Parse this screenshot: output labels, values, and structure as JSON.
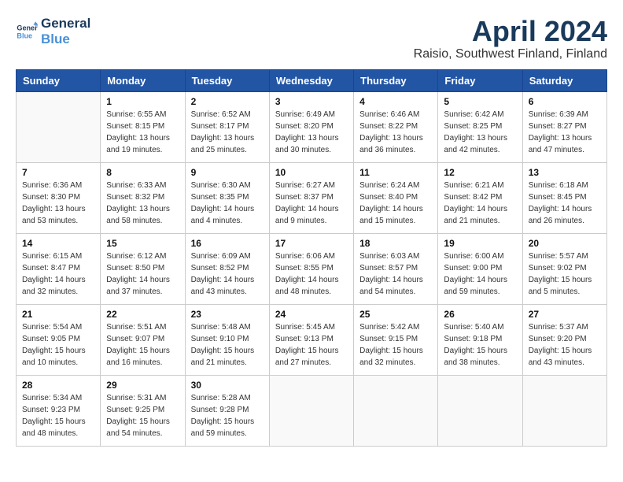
{
  "logo": {
    "line1": "General",
    "line2": "Blue"
  },
  "title": "April 2024",
  "location": "Raisio, Southwest Finland, Finland",
  "days_of_week": [
    "Sunday",
    "Monday",
    "Tuesday",
    "Wednesday",
    "Thursday",
    "Friday",
    "Saturday"
  ],
  "weeks": [
    [
      {
        "day": "",
        "info": ""
      },
      {
        "day": "1",
        "info": "Sunrise: 6:55 AM\nSunset: 8:15 PM\nDaylight: 13 hours\nand 19 minutes."
      },
      {
        "day": "2",
        "info": "Sunrise: 6:52 AM\nSunset: 8:17 PM\nDaylight: 13 hours\nand 25 minutes."
      },
      {
        "day": "3",
        "info": "Sunrise: 6:49 AM\nSunset: 8:20 PM\nDaylight: 13 hours\nand 30 minutes."
      },
      {
        "day": "4",
        "info": "Sunrise: 6:46 AM\nSunset: 8:22 PM\nDaylight: 13 hours\nand 36 minutes."
      },
      {
        "day": "5",
        "info": "Sunrise: 6:42 AM\nSunset: 8:25 PM\nDaylight: 13 hours\nand 42 minutes."
      },
      {
        "day": "6",
        "info": "Sunrise: 6:39 AM\nSunset: 8:27 PM\nDaylight: 13 hours\nand 47 minutes."
      }
    ],
    [
      {
        "day": "7",
        "info": "Sunrise: 6:36 AM\nSunset: 8:30 PM\nDaylight: 13 hours\nand 53 minutes."
      },
      {
        "day": "8",
        "info": "Sunrise: 6:33 AM\nSunset: 8:32 PM\nDaylight: 13 hours\nand 58 minutes."
      },
      {
        "day": "9",
        "info": "Sunrise: 6:30 AM\nSunset: 8:35 PM\nDaylight: 14 hours\nand 4 minutes."
      },
      {
        "day": "10",
        "info": "Sunrise: 6:27 AM\nSunset: 8:37 PM\nDaylight: 14 hours\nand 9 minutes."
      },
      {
        "day": "11",
        "info": "Sunrise: 6:24 AM\nSunset: 8:40 PM\nDaylight: 14 hours\nand 15 minutes."
      },
      {
        "day": "12",
        "info": "Sunrise: 6:21 AM\nSunset: 8:42 PM\nDaylight: 14 hours\nand 21 minutes."
      },
      {
        "day": "13",
        "info": "Sunrise: 6:18 AM\nSunset: 8:45 PM\nDaylight: 14 hours\nand 26 minutes."
      }
    ],
    [
      {
        "day": "14",
        "info": "Sunrise: 6:15 AM\nSunset: 8:47 PM\nDaylight: 14 hours\nand 32 minutes."
      },
      {
        "day": "15",
        "info": "Sunrise: 6:12 AM\nSunset: 8:50 PM\nDaylight: 14 hours\nand 37 minutes."
      },
      {
        "day": "16",
        "info": "Sunrise: 6:09 AM\nSunset: 8:52 PM\nDaylight: 14 hours\nand 43 minutes."
      },
      {
        "day": "17",
        "info": "Sunrise: 6:06 AM\nSunset: 8:55 PM\nDaylight: 14 hours\nand 48 minutes."
      },
      {
        "day": "18",
        "info": "Sunrise: 6:03 AM\nSunset: 8:57 PM\nDaylight: 14 hours\nand 54 minutes."
      },
      {
        "day": "19",
        "info": "Sunrise: 6:00 AM\nSunset: 9:00 PM\nDaylight: 14 hours\nand 59 minutes."
      },
      {
        "day": "20",
        "info": "Sunrise: 5:57 AM\nSunset: 9:02 PM\nDaylight: 15 hours\nand 5 minutes."
      }
    ],
    [
      {
        "day": "21",
        "info": "Sunrise: 5:54 AM\nSunset: 9:05 PM\nDaylight: 15 hours\nand 10 minutes."
      },
      {
        "day": "22",
        "info": "Sunrise: 5:51 AM\nSunset: 9:07 PM\nDaylight: 15 hours\nand 16 minutes."
      },
      {
        "day": "23",
        "info": "Sunrise: 5:48 AM\nSunset: 9:10 PM\nDaylight: 15 hours\nand 21 minutes."
      },
      {
        "day": "24",
        "info": "Sunrise: 5:45 AM\nSunset: 9:13 PM\nDaylight: 15 hours\nand 27 minutes."
      },
      {
        "day": "25",
        "info": "Sunrise: 5:42 AM\nSunset: 9:15 PM\nDaylight: 15 hours\nand 32 minutes."
      },
      {
        "day": "26",
        "info": "Sunrise: 5:40 AM\nSunset: 9:18 PM\nDaylight: 15 hours\nand 38 minutes."
      },
      {
        "day": "27",
        "info": "Sunrise: 5:37 AM\nSunset: 9:20 PM\nDaylight: 15 hours\nand 43 minutes."
      }
    ],
    [
      {
        "day": "28",
        "info": "Sunrise: 5:34 AM\nSunset: 9:23 PM\nDaylight: 15 hours\nand 48 minutes."
      },
      {
        "day": "29",
        "info": "Sunrise: 5:31 AM\nSunset: 9:25 PM\nDaylight: 15 hours\nand 54 minutes."
      },
      {
        "day": "30",
        "info": "Sunrise: 5:28 AM\nSunset: 9:28 PM\nDaylight: 15 hours\nand 59 minutes."
      },
      {
        "day": "",
        "info": ""
      },
      {
        "day": "",
        "info": ""
      },
      {
        "day": "",
        "info": ""
      },
      {
        "day": "",
        "info": ""
      }
    ]
  ]
}
